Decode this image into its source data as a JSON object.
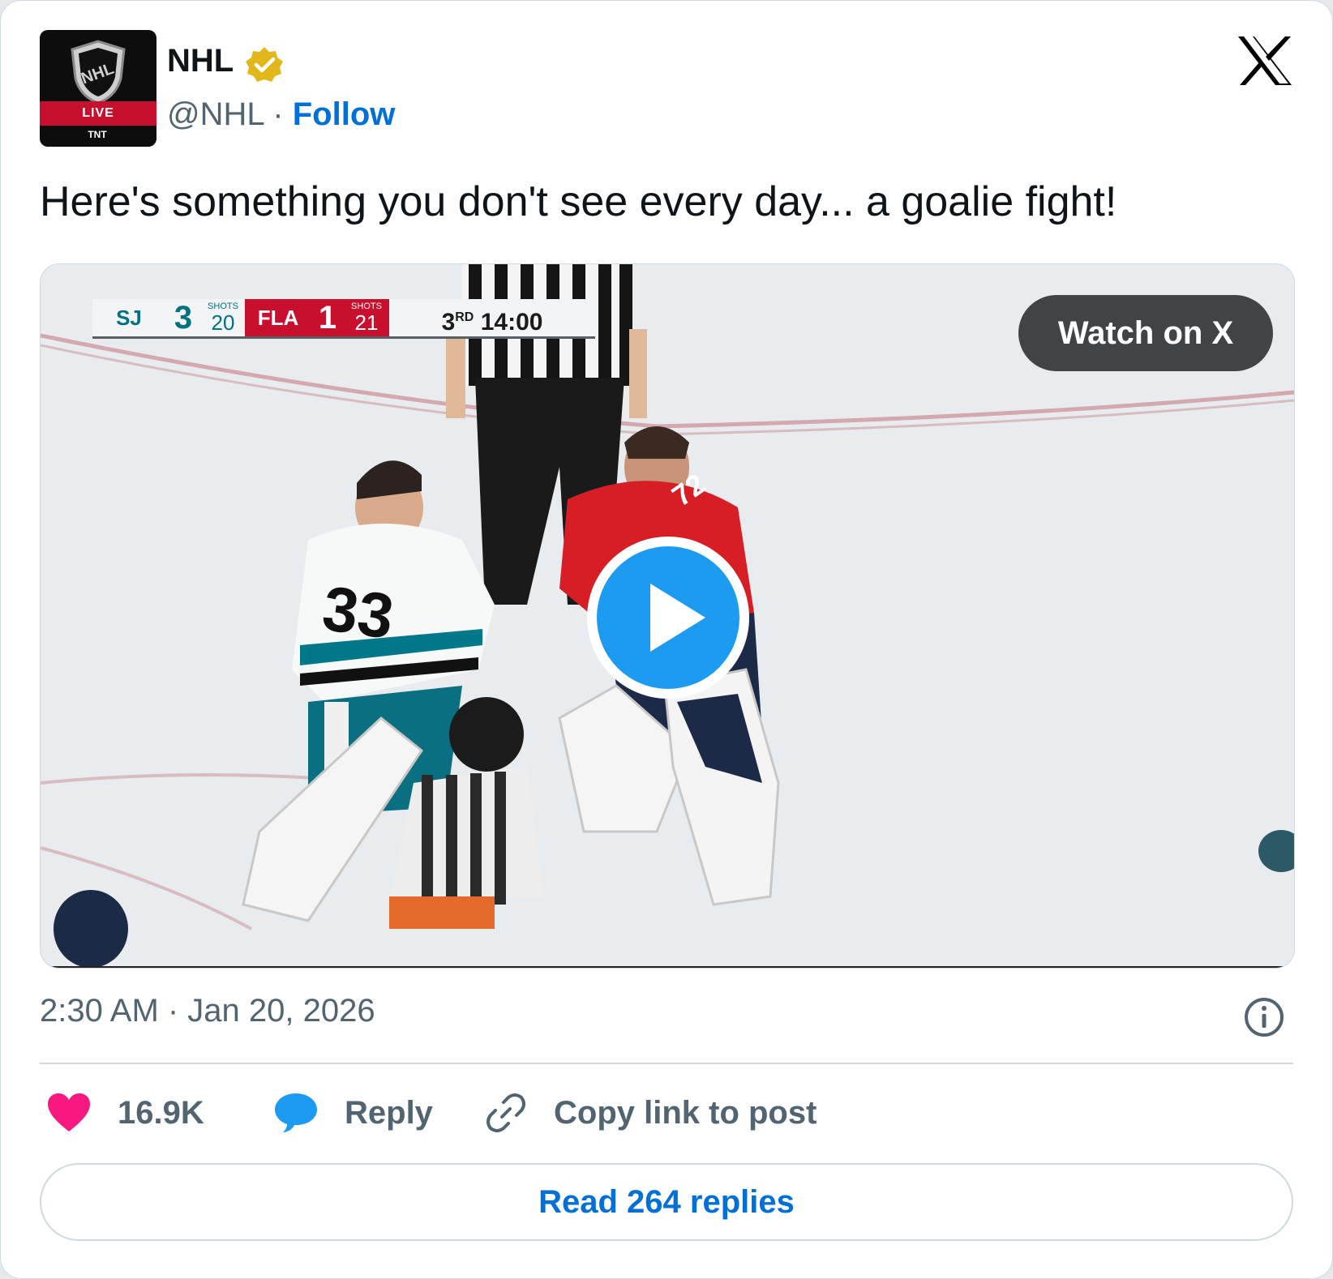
{
  "author": {
    "name": "NHL",
    "handle": "@NHL",
    "separator": "·",
    "follow_label": "Follow",
    "avatar_text": {
      "live": "LIVE",
      "network": "TNT"
    }
  },
  "post": {
    "text": "Here's something you don't see every day... a goalie fight!",
    "timestamp": "2:30 AM · Jan 20, 2026"
  },
  "media": {
    "watch_label": "Watch on X",
    "scorebug": {
      "team_a": "SJ",
      "score_a": "3",
      "shots_label": "SHOTS",
      "shots_a": "20",
      "team_b": "FLA",
      "score_b": "1",
      "shots_b": "21",
      "period": "3",
      "period_suffix": "RD",
      "clock": "14:00"
    },
    "jersey_numbers": {
      "left": "33",
      "right": "72"
    }
  },
  "actions": {
    "likes": "16.9K",
    "reply_label": "Reply",
    "copy_label": "Copy link to post",
    "read_replies_label": "Read 264 replies"
  },
  "colors": {
    "link": "#006fd6",
    "like": "#f91880",
    "reply": "#1d9bf0",
    "verified": "#e2b719",
    "secondary_text": "#536471"
  },
  "icons": [
    "nhl-shield-icon",
    "verified-badge-icon",
    "x-logo-icon",
    "play-icon",
    "info-icon",
    "heart-icon",
    "speech-bubble-icon",
    "link-icon"
  ]
}
